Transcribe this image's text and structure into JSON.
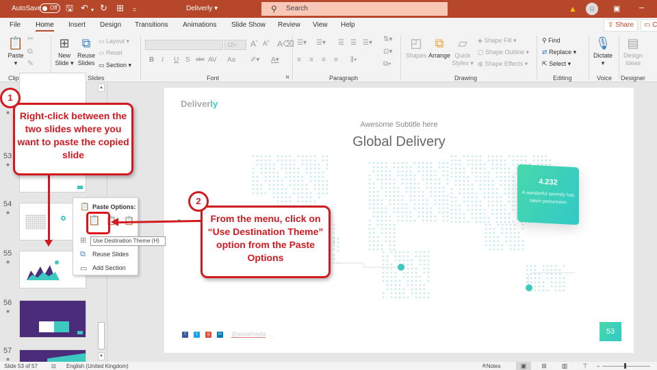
{
  "titlebar": {
    "autosave_label": "AutoSave",
    "autosave_state": "Off",
    "doc_title": "Deliverly ▾",
    "search_placeholder": "Search",
    "icons": [
      "save-icon",
      "undo-icon",
      "redo-icon",
      "present-icon",
      "customize-icon"
    ]
  },
  "menu": {
    "tabs": [
      "File",
      "Home",
      "Insert",
      "Design",
      "Transitions",
      "Animations",
      "Slide Show",
      "Review",
      "View",
      "Help"
    ],
    "active": "Home",
    "share_label": "Share",
    "comments_label": "C"
  },
  "ribbon": {
    "clipboard": {
      "label": "Clipboard",
      "paste": "Paste"
    },
    "slides": {
      "label": "Slides",
      "new_slide": "New Slide ▾",
      "reuse_slides": "Reuse Slides",
      "layout": "Layout ▾",
      "reset": "Reset",
      "section": "Section ▾"
    },
    "font": {
      "label": "Font",
      "size_placeholder": "12+",
      "format_buttons": [
        "B",
        "I",
        "U",
        "S",
        "abc",
        "AV",
        "Aa"
      ]
    },
    "paragraph": {
      "label": "Paragraph"
    },
    "drawing": {
      "label": "Drawing",
      "shapes": "Shapes",
      "arrange": "Arrange",
      "quick_styles": "Quick Styles ▾",
      "shape_fill": "Shape Fill ▾",
      "shape_outline": "Shape Outline ▾",
      "shape_effects": "Shape Effects ▾"
    },
    "editing": {
      "label": "Editing",
      "find": "Find",
      "replace": "Replace",
      "select": "Select ▾"
    },
    "voice": {
      "label": "Voice",
      "dictate": "Dictate"
    },
    "designer": {
      "label": "Designer",
      "design_ideas": "Design Ideas"
    }
  },
  "slides_pane": {
    "items": [
      {
        "number": "53",
        "theme": "light"
      },
      {
        "number": "54",
        "theme": "light"
      },
      {
        "number": "55",
        "theme": "light"
      },
      {
        "number": "56",
        "theme": "purple"
      },
      {
        "number": "57",
        "theme": "purple"
      }
    ],
    "star": "★"
  },
  "context_menu": {
    "header": "Paste Options:",
    "tooltip": "Use Destination Theme (H)",
    "items": [
      {
        "label": "Reuse Slides",
        "accel": "R"
      },
      {
        "label": "Add Section",
        "accel": "A"
      }
    ]
  },
  "slide": {
    "logo_main": "Deliver",
    "logo_accent": "ly",
    "subtitle": "Awesome Subtitle here",
    "title": "Global Delivery",
    "stat_value": "4.232",
    "stat_desc": "A wonderful serenity has taken possession",
    "social_handle": "@socialmedia",
    "social_icons": [
      {
        "name": "facebook",
        "glyph": "f",
        "color": "#3b5998"
      },
      {
        "name": "twitter",
        "glyph": "t",
        "color": "#1da1f2"
      },
      {
        "name": "google-plus",
        "glyph": "g",
        "color": "#dd4b39"
      },
      {
        "name": "linkedin",
        "glyph": "in",
        "color": "#0077b5"
      }
    ],
    "page_number": "53",
    "accent_color": "#3cc9c0"
  },
  "callouts": {
    "step1_number": "1",
    "step1_text": "Right-click between the two slides where you want to paste the copied slide",
    "step2_number": "2",
    "step2_text": "From the menu, click on “Use Destination Theme” option from the Paste Options",
    "color": "#d11920"
  },
  "statusbar": {
    "slide_info": "Slide 53 of 57",
    "language": "English (United Kingdom)",
    "notes": "Notes"
  }
}
